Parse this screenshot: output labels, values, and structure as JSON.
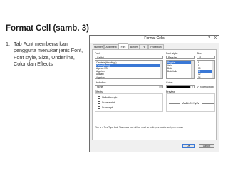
{
  "slide": {
    "title": "Format Cell (samb. 3)",
    "bullet_number": "1.",
    "bullet_text": "Tab Font membenarkan pengguna menukar jenis Font, Font style, Size, Underline, Color dan Effects"
  },
  "dialog": {
    "title": "Format Cells",
    "help_button": "?",
    "close_button": "X",
    "tabs": [
      "Number",
      "Alignment",
      "Font",
      "Border",
      "Fill",
      "Protection"
    ],
    "active_tab": "Font",
    "font": {
      "label": "Font:",
      "value": "Calibri",
      "items": [
        "Cambria (Headings)",
        "Calibri (Body)",
        "Agency FB",
        "Algerian",
        "Aldhabi",
        "Algerian"
      ],
      "selected_index": 1
    },
    "font_style": {
      "label": "Font style:",
      "value": "Regular",
      "items": [
        "Regular",
        "Italic",
        "Bold",
        "Bold Italic"
      ],
      "selected_index": 0
    },
    "size": {
      "label": "Size:",
      "value": "11",
      "items": [
        "8",
        "9",
        "10",
        "11",
        "12",
        "14"
      ],
      "selected_index": 3
    },
    "underline": {
      "label": "Underline:",
      "value": "None"
    },
    "color": {
      "label": "Color:",
      "swatch": "#000000"
    },
    "normal_font": {
      "label": "Normal font",
      "checked": true
    },
    "effects": {
      "label": "Effects",
      "items": [
        {
          "label": "Strikethrough",
          "checked": false
        },
        {
          "label": "Superscript",
          "checked": false
        },
        {
          "label": "Subscript",
          "checked": false
        }
      ]
    },
    "preview": {
      "label": "Preview",
      "sample": "AaBbCcYyZz"
    },
    "note": "This is a TrueType font. The same font will be used on both your printer and your screen.",
    "ok_label": "OK",
    "cancel_label": "Cancel"
  }
}
